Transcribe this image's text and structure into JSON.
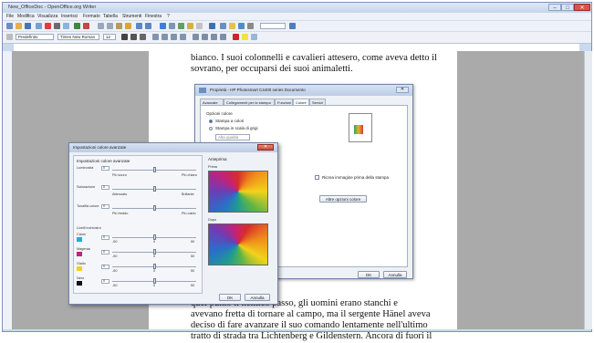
{
  "window": {
    "title": "New_OfficeDoc - OpenOffice.org Writer",
    "controls": {
      "minimize": "–",
      "maximize": "□",
      "close": "✕"
    }
  },
  "menubar": [
    "File",
    "Modifica",
    "Visualizza",
    "Inserisci",
    "Formato",
    "Tabella",
    "Strumenti",
    "Finestra",
    "?"
  ],
  "toolbar2": {
    "style": "Predefinito",
    "font": "Times New Roman",
    "size": "12"
  },
  "document": {
    "line1": "bianco. I suoi colonnelli e cavalieri attesero, come aveva detto il",
    "line2": "sovrano, per occuparsi dei suoi animaletti.",
    "bottom": [
      "quel punto il nemico passo, gli uomini erano stanchi e",
      "avevano fretta di tornare al campo, ma il sergente Hänel aveva",
      "deciso di fare avanzare il suo comando lentamente nell'ultimo",
      "tratto di strada tra Lichtenberg e Gildenstern. Ancora di fuori il"
    ]
  },
  "printer_dialog": {
    "title": "Proprietà - HP Photosmart C4400 series Documento",
    "tabs": [
      "Avanzate",
      "Collegamenti per la stampa",
      "Funzioni",
      "Colore",
      "Servizi"
    ],
    "active_tab": "Colore",
    "group_label": "Opzioni colore",
    "radio_color": "Stampa a colori",
    "radio_gray": "Stampa in scala di grigi",
    "gray_select": "Alta qualità",
    "checkbox_label": "Ricrea immagine prima della stampa",
    "advanced_button": "Altre opzioni colore",
    "ok": "OK",
    "cancel": "Annulla"
  },
  "color_dialog": {
    "title": "Impostazioni colore avanzate",
    "section": "Impostazioni colore avanzate",
    "preview_label": "Anteprima",
    "before_label": "Prima",
    "after_label": "Dopo",
    "sliders": [
      {
        "label": "Luminosità",
        "value": "0",
        "left": "Più scuro",
        "right": "Più chiaro",
        "level": 0.5
      },
      {
        "label": "Saturazione",
        "value": "0",
        "left": "Attenuato",
        "right": "Brillante",
        "level": 0.5
      },
      {
        "label": "Tonalità colore",
        "value": "0",
        "left": "Più freddo",
        "right": "Più caldo",
        "level": 0.5
      }
    ],
    "ink_header": "Livelli inchiostro",
    "inks": [
      {
        "label": "Ciano",
        "color": "#29a9d6",
        "value": "0",
        "min": "-50",
        "mid": "0",
        "max": "50",
        "level": 0.5
      },
      {
        "label": "Magenta",
        "color": "#c2227a",
        "value": "0",
        "min": "-50",
        "mid": "0",
        "max": "50",
        "level": 0.5
      },
      {
        "label": "Giallo",
        "color": "#f2d21a",
        "value": "0",
        "min": "-50",
        "mid": "0",
        "max": "50",
        "level": 0.5
      },
      {
        "label": "Nero",
        "color": "#111111",
        "value": "0",
        "min": "-50",
        "mid": "0",
        "max": "50",
        "level": 0.5
      }
    ],
    "ok": "OK",
    "cancel": "Annulla"
  }
}
